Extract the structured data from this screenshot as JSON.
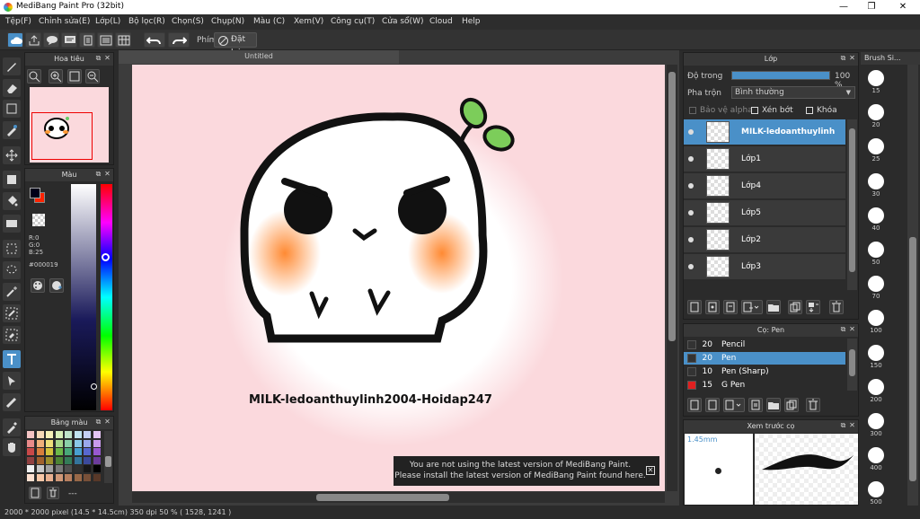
{
  "window": {
    "title": "MediBang Paint Pro (32bit)",
    "min": "—",
    "max": "❐",
    "close": "✕"
  },
  "menu": [
    "Tệp(F)",
    "Chỉnh sửa(E)",
    "Lớp(L)",
    "Bộ lọc(R)",
    "Chọn(S)",
    "Chụp(N)",
    "Màu (C)",
    "Xem(V)",
    "Công cụ(T)",
    "Cửa sổ(W)",
    "Cloud",
    "Help"
  ],
  "toolbar": {
    "keys_label": "Phím",
    "reset_label": "Đặt lại"
  },
  "navigator": {
    "title": "Hoa tiêu"
  },
  "color": {
    "title": "Màu",
    "r": "R:0",
    "g": "G:0",
    "b": "B:25",
    "hex": "#000019",
    "primary": "#000019",
    "secondary": "#ff2200"
  },
  "palette": {
    "title": "Bảng màu",
    "footer": "---"
  },
  "document": {
    "tab": "Untitled",
    "watermark": "MILK-ledoanthuylinh2004-Hoidap247"
  },
  "notice": {
    "line1": "You are not using the latest version of MediBang Paint.",
    "line2": "Please install the latest version of MediBang Paint found here."
  },
  "status": {
    "text": "2000 * 2000 pixel   (14.5 * 14.5cm)   350 dpi   50 %   ( 1528, 1241 )"
  },
  "layers": {
    "title": "Lớp",
    "opacity_label": "Độ trong",
    "opacity_value": "100 %",
    "opacity": 1.0,
    "blend_label": "Pha trộn",
    "blend_value": "Bình thường",
    "protect_alpha": "Bảo vệ alpha",
    "clip": "Xén bớt",
    "lock": "Khóa",
    "items": [
      {
        "name": "MILK-ledoanthuylinh",
        "selected": true
      },
      {
        "name": "Lớp1",
        "selected": false
      },
      {
        "name": "Lớp4",
        "selected": false
      },
      {
        "name": "Lớp5",
        "selected": false
      },
      {
        "name": "Lớp2",
        "selected": false
      },
      {
        "name": "Lớp3",
        "selected": false
      }
    ]
  },
  "brushes": {
    "title": "Cọ: Pen",
    "items": [
      {
        "size": "20",
        "name": "Pencil",
        "color": "#333333",
        "selected": false
      },
      {
        "size": "20",
        "name": "Pen",
        "color": "#333333",
        "selected": true
      },
      {
        "size": "10",
        "name": "Pen (Sharp)",
        "color": "#333333",
        "selected": false
      },
      {
        "size": "15",
        "name": "G Pen",
        "color": "#e02020",
        "selected": false
      }
    ]
  },
  "preview": {
    "title": "Xem trước cọ",
    "size": "1.45mm"
  },
  "brush_size": {
    "title": "Brush Si...",
    "values": [
      "15",
      "20",
      "25",
      "30",
      "40",
      "50",
      "70",
      "100",
      "150",
      "200",
      "300",
      "400",
      "500"
    ]
  }
}
